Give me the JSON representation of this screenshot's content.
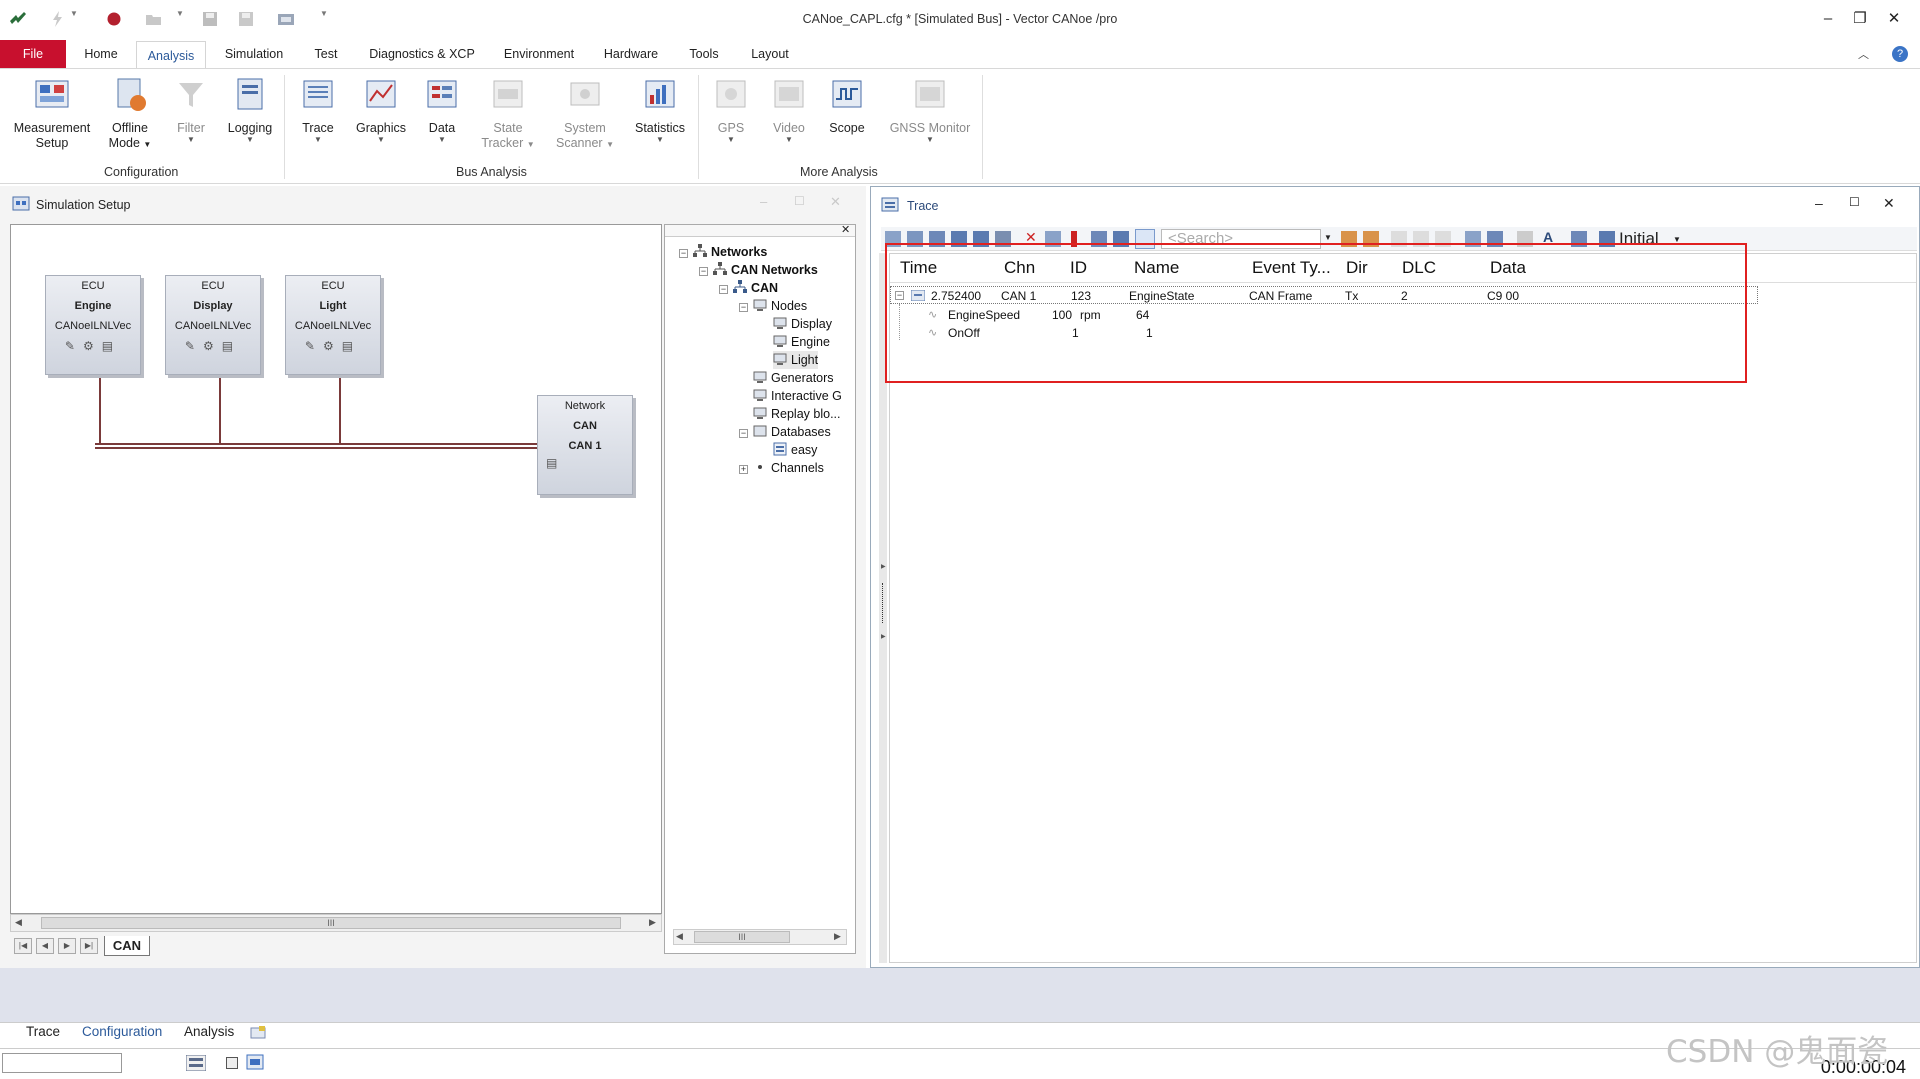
{
  "window": {
    "title": "CANoe_CAPL.cfg * [Simulated Bus] - Vector CANoe /pro"
  },
  "tabs": [
    "File",
    "Home",
    "Analysis",
    "Simulation",
    "Test",
    "Diagnostics & XCP",
    "Environment",
    "Hardware",
    "Tools",
    "Layout"
  ],
  "ribbon": {
    "config": {
      "label": "Configuration",
      "buttons": [
        {
          "l1": "Measurement",
          "l2": "Setup"
        },
        {
          "l1": "Offline",
          "l2": "Mode"
        },
        {
          "l1": "Filter",
          "l2": ""
        },
        {
          "l1": "Logging",
          "l2": ""
        }
      ]
    },
    "bus": {
      "label": "Bus Analysis",
      "buttons": [
        {
          "l1": "Trace",
          "l2": ""
        },
        {
          "l1": "Graphics",
          "l2": ""
        },
        {
          "l1": "Data",
          "l2": ""
        },
        {
          "l1": "State",
          "l2": "Tracker"
        },
        {
          "l1": "System",
          "l2": "Scanner"
        },
        {
          "l1": "Statistics",
          "l2": ""
        }
      ]
    },
    "more": {
      "label": "More Analysis",
      "buttons": [
        {
          "l1": "GPS",
          "l2": ""
        },
        {
          "l1": "Video",
          "l2": ""
        },
        {
          "l1": "Scope",
          "l2": ""
        },
        {
          "l1": "GNSS Monitor",
          "l2": ""
        }
      ]
    }
  },
  "simulation": {
    "title": "Simulation Setup",
    "ecus": [
      {
        "top": "ECU",
        "name": "Engine",
        "lib": "CANoeILNLVec"
      },
      {
        "top": "ECU",
        "name": "Display",
        "lib": "CANoeILNLVec"
      },
      {
        "top": "ECU",
        "name": "Light",
        "lib": "CANoeILNLVec"
      }
    ],
    "network": {
      "top": "Network",
      "name": "CAN",
      "channel": "CAN 1"
    },
    "sheet_tab": "CAN",
    "scroll_mark": "III"
  },
  "tree": {
    "items": [
      {
        "label": "Networks",
        "bold": true
      },
      {
        "label": "CAN Networks",
        "bold": true
      },
      {
        "label": "CAN",
        "bold": true
      },
      {
        "label": "Nodes",
        "bold": false
      },
      {
        "label": "Display",
        "bold": false
      },
      {
        "label": "Engine",
        "bold": false
      },
      {
        "label": "Light",
        "bold": false
      },
      {
        "label": "Generators",
        "bold": false
      },
      {
        "label": "Interactive G",
        "bold": false
      },
      {
        "label": "Replay blo...",
        "bold": false
      },
      {
        "label": "Databases",
        "bold": false
      },
      {
        "label": "easy",
        "bold": false
      },
      {
        "label": "Channels",
        "bold": false
      }
    ],
    "scroll_mark": "III"
  },
  "trace": {
    "title": "Trace",
    "search_placeholder": "<Search>",
    "layout_name": "Initial",
    "columns": [
      "Time",
      "Chn",
      "ID",
      "Name",
      "Event Ty...",
      "Dir",
      "DLC",
      "Data"
    ],
    "row": {
      "time": "2.752400",
      "chn": "CAN 1",
      "id": "123",
      "name": "EngineState",
      "type": "CAN Frame",
      "dir": "Tx",
      "dlc": "2",
      "data": "C9 00"
    },
    "signals": [
      {
        "name": "EngineSpeed",
        "value": "100",
        "unit": "rpm",
        "raw": "64"
      },
      {
        "name": "OnOff",
        "value": "1",
        "unit": "",
        "raw": "1"
      }
    ]
  },
  "bottom": {
    "tabs": [
      "Trace",
      "Configuration",
      "Analysis"
    ],
    "clock": "0:00:00:04"
  },
  "watermark": "CSDN @鬼面瓷",
  "colors": {
    "file_tab": "#c8102e",
    "active_tab": "#2c5a9a",
    "highlight": "#e02020"
  }
}
